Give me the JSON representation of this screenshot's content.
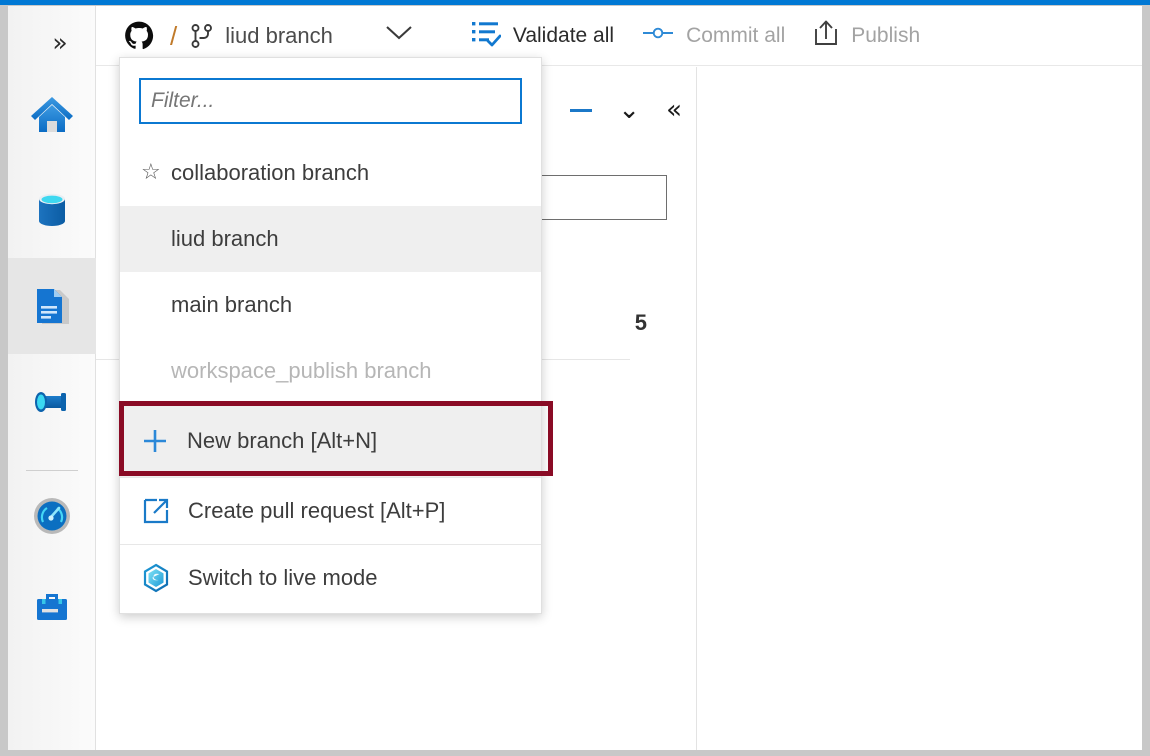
{
  "theme": {
    "accent": "#0078d4",
    "highlight_box": "#8a0b25",
    "row_selected_bg": "#efefef",
    "focus_border": "#0b78d1"
  },
  "left_rail": {
    "expand_icon": "chevron-double-right-icon",
    "items": [
      {
        "name": "home",
        "icon": "home-icon",
        "selected": false
      },
      {
        "name": "data",
        "icon": "database-icon",
        "selected": false
      },
      {
        "name": "author",
        "icon": "document-pencil-icon",
        "selected": true
      },
      {
        "name": "integrate",
        "icon": "pipeline-icon",
        "selected": false
      },
      {
        "name": "monitor",
        "icon": "monitor-gauge-icon",
        "selected": false
      },
      {
        "name": "manage",
        "icon": "toolbox-icon",
        "selected": false
      }
    ]
  },
  "command_bar": {
    "repo_icon": "github-icon",
    "separator": "/",
    "branch_icon": "git-branch-icon",
    "branch_label": "liud branch",
    "caret_icon": "chevron-down-icon",
    "actions": [
      {
        "label": "Validate all",
        "icon": "validate-all-icon",
        "disabled": false
      },
      {
        "label": "Commit all",
        "icon": "commit-icon",
        "disabled": true
      },
      {
        "label": "Publish",
        "icon": "publish-upload-icon",
        "disabled": true
      }
    ]
  },
  "left_pane": {
    "collapse_all_icon": "chevron-double-down-icon",
    "collapse_pane_icon": "chevron-double-left-icon",
    "search_value": "",
    "item_count": "5"
  },
  "branch_dropdown": {
    "filter_placeholder": "Filter...",
    "filter_value": "",
    "items": [
      {
        "label": "collaboration branch",
        "icon": "star-icon",
        "state": "normal"
      },
      {
        "label": "liud branch",
        "icon": "",
        "state": "selected"
      },
      {
        "label": "main branch",
        "icon": "",
        "state": "normal"
      },
      {
        "label": "workspace_publish branch",
        "icon": "",
        "state": "disabled"
      }
    ],
    "actions": [
      {
        "label": "New branch [Alt+N]",
        "icon": "plus-icon",
        "highlighted": true
      },
      {
        "label": "Create pull request [Alt+P]",
        "icon": "external-link-icon",
        "highlighted": false
      },
      {
        "label": "Switch to live mode",
        "icon": "synapse-hexagon-icon",
        "highlighted": false
      }
    ]
  }
}
